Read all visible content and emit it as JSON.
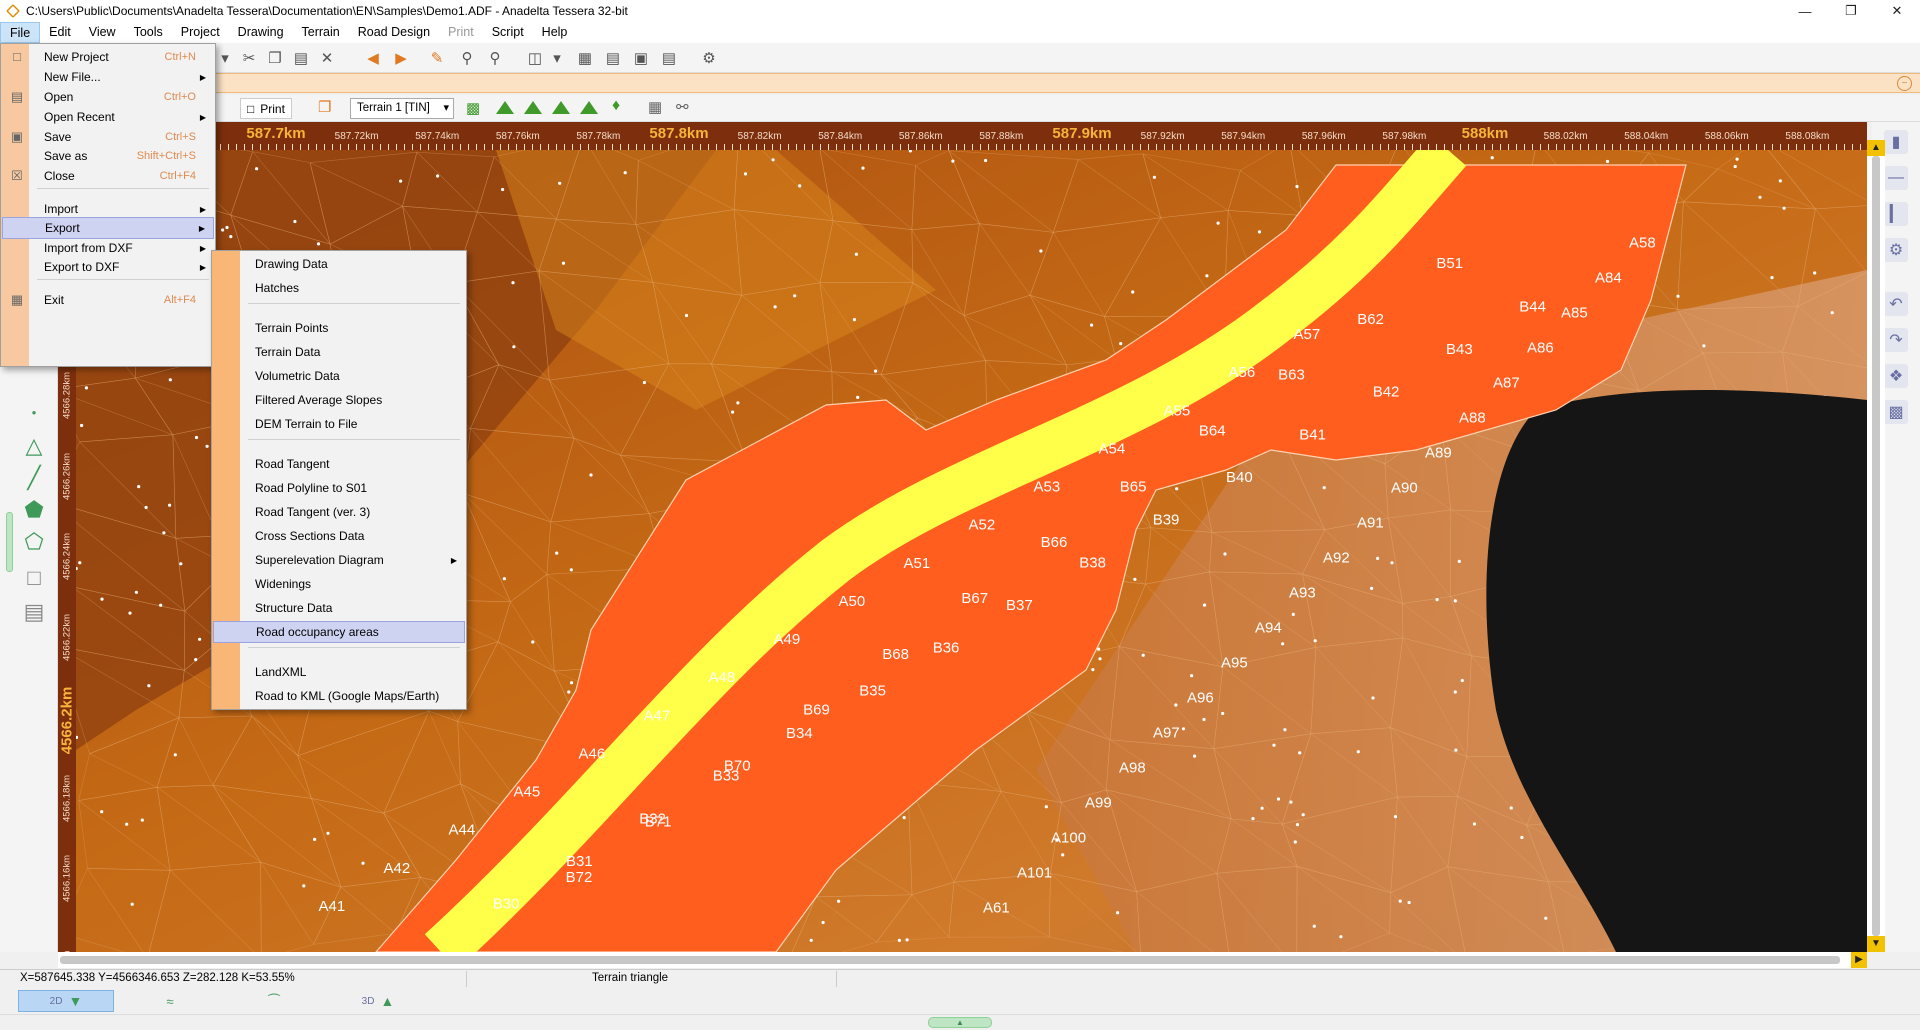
{
  "window": {
    "title": "C:\\Users\\Public\\Documents\\Anadelta Tessera\\Documentation\\EN\\Samples\\Demo1.ADF - Anadelta Tessera 32-bit"
  },
  "menubar": [
    "File",
    "Edit",
    "View",
    "Tools",
    "Project",
    "Drawing",
    "Terrain",
    "Road Design",
    "Print",
    "Script",
    "Help"
  ],
  "toolbar2": {
    "print_label": "Print",
    "terrain_select": "Terrain 1 [TIN]"
  },
  "file_menu": [
    {
      "label": "New Project",
      "shortcut": "Ctrl+N"
    },
    {
      "label": "New File...",
      "submenu": true
    },
    {
      "label": "Open",
      "shortcut": "Ctrl+O"
    },
    {
      "label": "Open Recent",
      "submenu": true
    },
    {
      "label": "Save",
      "shortcut": "Ctrl+S"
    },
    {
      "label": "Save as",
      "shortcut": "Shift+Ctrl+S"
    },
    {
      "label": "Close",
      "shortcut": "Ctrl+F4"
    },
    {
      "label": "Import",
      "submenu": true
    },
    {
      "label": "Export",
      "submenu": true,
      "highlight": true
    },
    {
      "label": "Import from DXF",
      "submenu": true
    },
    {
      "label": "Export to DXF",
      "submenu": true
    },
    {
      "label": "Exit",
      "shortcut": "Alt+F4"
    }
  ],
  "export_menu": [
    {
      "label": "Drawing Data"
    },
    {
      "label": "Hatches"
    },
    {
      "label": "Terrain Points"
    },
    {
      "label": "Terrain Data"
    },
    {
      "label": "Volumetric Data"
    },
    {
      "label": "Filtered Average Slopes"
    },
    {
      "label": "DEM Terrain to File"
    },
    {
      "label": "Road Tangent"
    },
    {
      "label": "Road Polyline to S01"
    },
    {
      "label": "Road Tangent (ver. 3)"
    },
    {
      "label": "Cross Sections Data"
    },
    {
      "label": "Superelevation Diagram",
      "submenu": true
    },
    {
      "label": "Widenings"
    },
    {
      "label": "Structure Data"
    },
    {
      "label": "Road occupancy areas",
      "highlight": true
    },
    {
      "label": "LandXML"
    },
    {
      "label": "Road to KML (Google Maps/Earth)"
    }
  ],
  "hruler": [
    {
      "label": "587.7km",
      "major": true
    },
    {
      "label": "587.72km"
    },
    {
      "label": "587.74km"
    },
    {
      "label": "587.76km"
    },
    {
      "label": "587.78km"
    },
    {
      "label": "587.8km",
      "major": true
    },
    {
      "label": "587.82km"
    },
    {
      "label": "587.84km"
    },
    {
      "label": "587.86km"
    },
    {
      "label": "587.88km"
    },
    {
      "label": "587.9km",
      "major": true
    },
    {
      "label": "587.92km"
    },
    {
      "label": "587.94km"
    },
    {
      "label": "587.96km"
    },
    {
      "label": "587.98km"
    },
    {
      "label": "588km",
      "major": true
    },
    {
      "label": "588.02km"
    },
    {
      "label": "588.04km"
    },
    {
      "label": "588.06km"
    },
    {
      "label": "588.08km"
    }
  ],
  "vruler": [
    {
      "label": "4566.28km"
    },
    {
      "label": "4566.26km"
    },
    {
      "label": "4566.24km"
    },
    {
      "label": "4566.22km"
    },
    {
      "label": "4566.2km",
      "major": true
    },
    {
      "label": "4566.18km"
    },
    {
      "label": "4566.16km"
    },
    {
      "label": "4km"
    }
  ],
  "map_labels": {
    "A": [
      "A41",
      "A42",
      "A44",
      "A45",
      "A46",
      "A47",
      "A48",
      "A49",
      "A50",
      "A51",
      "A52",
      "A53",
      "A54",
      "A55",
      "A56",
      "A57",
      "A58",
      "A84",
      "A85",
      "A86",
      "A87",
      "A88",
      "A89",
      "A90",
      "A91",
      "A92",
      "A93",
      "A94",
      "A95",
      "A96",
      "A97",
      "A98",
      "A99",
      "A100",
      "A101",
      "A61"
    ],
    "B": [
      "B30",
      "B31",
      "B32",
      "B33",
      "B34",
      "B35",
      "B36",
      "B37",
      "B38",
      "B39",
      "B40",
      "B41",
      "B42",
      "B43",
      "B44",
      "B51",
      "B62",
      "B63",
      "B64",
      "B65",
      "B66",
      "B67",
      "B68",
      "B69",
      "B70",
      "B71",
      "B72"
    ]
  },
  "statusbar": {
    "coords": "X=587645.338  Y=4566346.653  Z=282.128  K=53.55%",
    "info": "Terrain triangle"
  },
  "viewtabs": [
    "2D",
    "",
    "",
    "3D"
  ],
  "colors": {
    "terrain_dark": "#8a3f0e",
    "terrain": "#b85d12",
    "terrain_light": "#d78a3a",
    "road_fill": "#ff5e1f",
    "road_center": "#ffff4a",
    "void": "#151515",
    "menu_gutter": "#f9b677",
    "highlight": "#cfd3f2"
  }
}
